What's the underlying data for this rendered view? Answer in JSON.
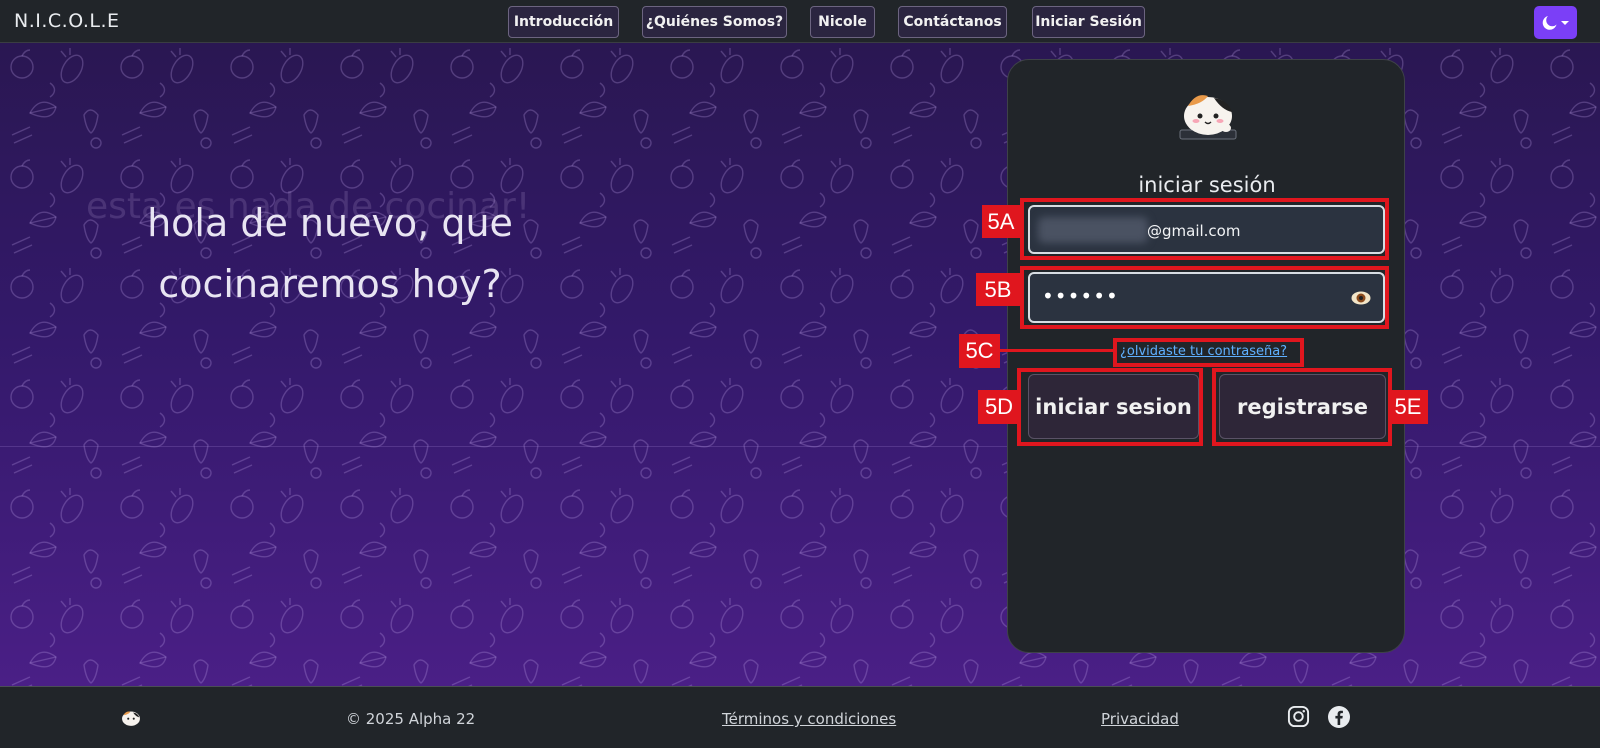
{
  "navbar": {
    "brand": "N.I.C.O.L.E",
    "items": [
      {
        "label": "Introducción"
      },
      {
        "label": "¿Quiénes Somos?"
      },
      {
        "label": "Nicole"
      },
      {
        "label": "Contáctanos"
      },
      {
        "label": "Iniciar Sesión"
      }
    ],
    "theme_icon": "moon-icon"
  },
  "hero": {
    "ghost_text": "esta es nada de cocinar!",
    "headline": "hola de nuevo, que cocinaremos hoy?"
  },
  "login": {
    "title": "iniciar sesión",
    "email_value": "@gmail.com",
    "password_value": "••••••",
    "forgot_label": "¿olvidaste tu contraseña?",
    "login_button": "iniciar sesion",
    "register_button": "registrarse"
  },
  "annotations": {
    "a": "5A",
    "b": "5B",
    "c": "5C",
    "d": "5D",
    "e": "5E"
  },
  "footer": {
    "copyright": "© 2025 Alpha 22",
    "terms": "Términos y condiciones",
    "privacy": "Privacidad",
    "social": [
      "instagram-icon",
      "facebook-icon"
    ]
  },
  "colors": {
    "accent": "#7b3ff7",
    "annotation": "#e0161e",
    "link": "#5fb0ff"
  }
}
